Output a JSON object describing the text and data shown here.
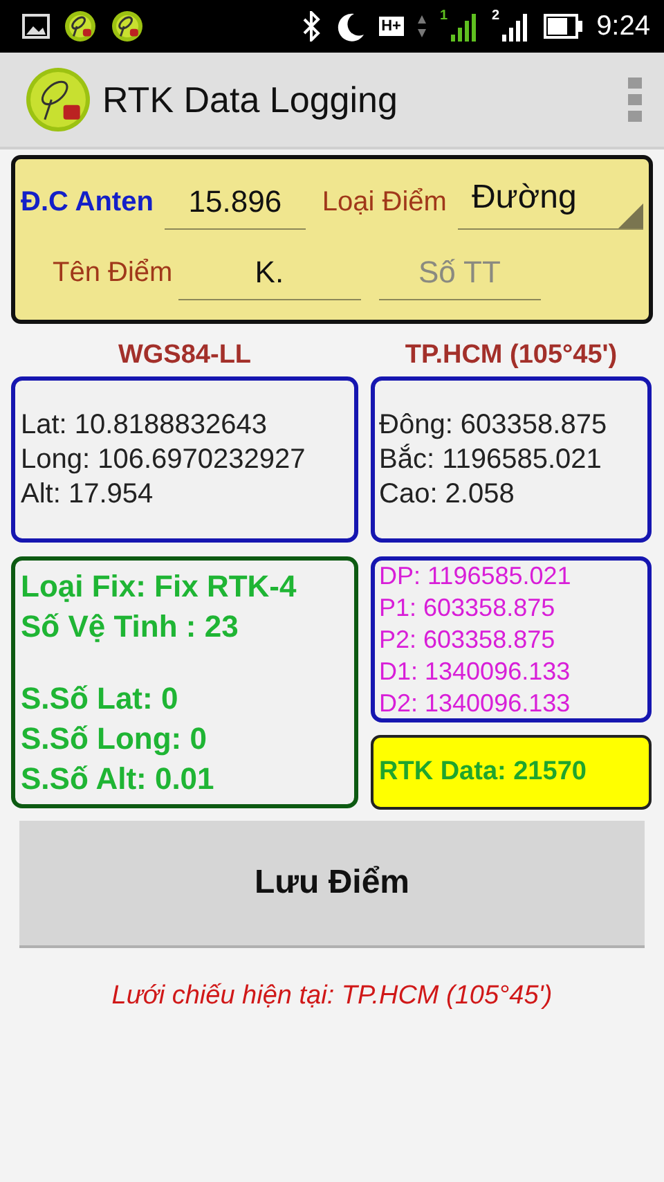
{
  "status_bar": {
    "network_type": "H+",
    "sim_labels": [
      "1",
      "2"
    ],
    "time": "9:24"
  },
  "app_bar": {
    "title": "RTK Data Logging"
  },
  "settings": {
    "antenna_label": "Đ.C Anten",
    "antenna_value": "15.896",
    "point_type_label": "Loại Điểm",
    "point_type_value": "Đường",
    "point_name_label": "Tên Điểm",
    "point_name_value": "K.",
    "number_placeholder": "Số TT"
  },
  "wgs84": {
    "title": "WGS84-LL",
    "lines": [
      "Lat: 10.8188832643",
      "Long: 106.6970232927",
      "Alt: 17.954"
    ]
  },
  "projected": {
    "title": "TP.HCM (105°45')",
    "lines": [
      "Đông: 603358.875",
      "Bắc: 1196585.021",
      "Cao: 2.058"
    ]
  },
  "fix": {
    "lines": [
      "Loại Fix: Fix RTK-4",
      "Số Vệ Tinh : 23"
    ],
    "accuracy": [
      "S.Số Lat: 0",
      "S.Số Long: 0",
      "S.Số Alt: 0.01"
    ]
  },
  "distances": [
    "DP: 1196585.021",
    "P1: 603358.875",
    "P2: 603358.875",
    "D1: 1340096.133",
    "D2: 1340096.133"
  ],
  "rtk_data": "RTK Data: 21570",
  "save_button": "Lưu Điểm",
  "footer": "Lưới chiếu hiện tại: TP.HCM (105°45')"
}
